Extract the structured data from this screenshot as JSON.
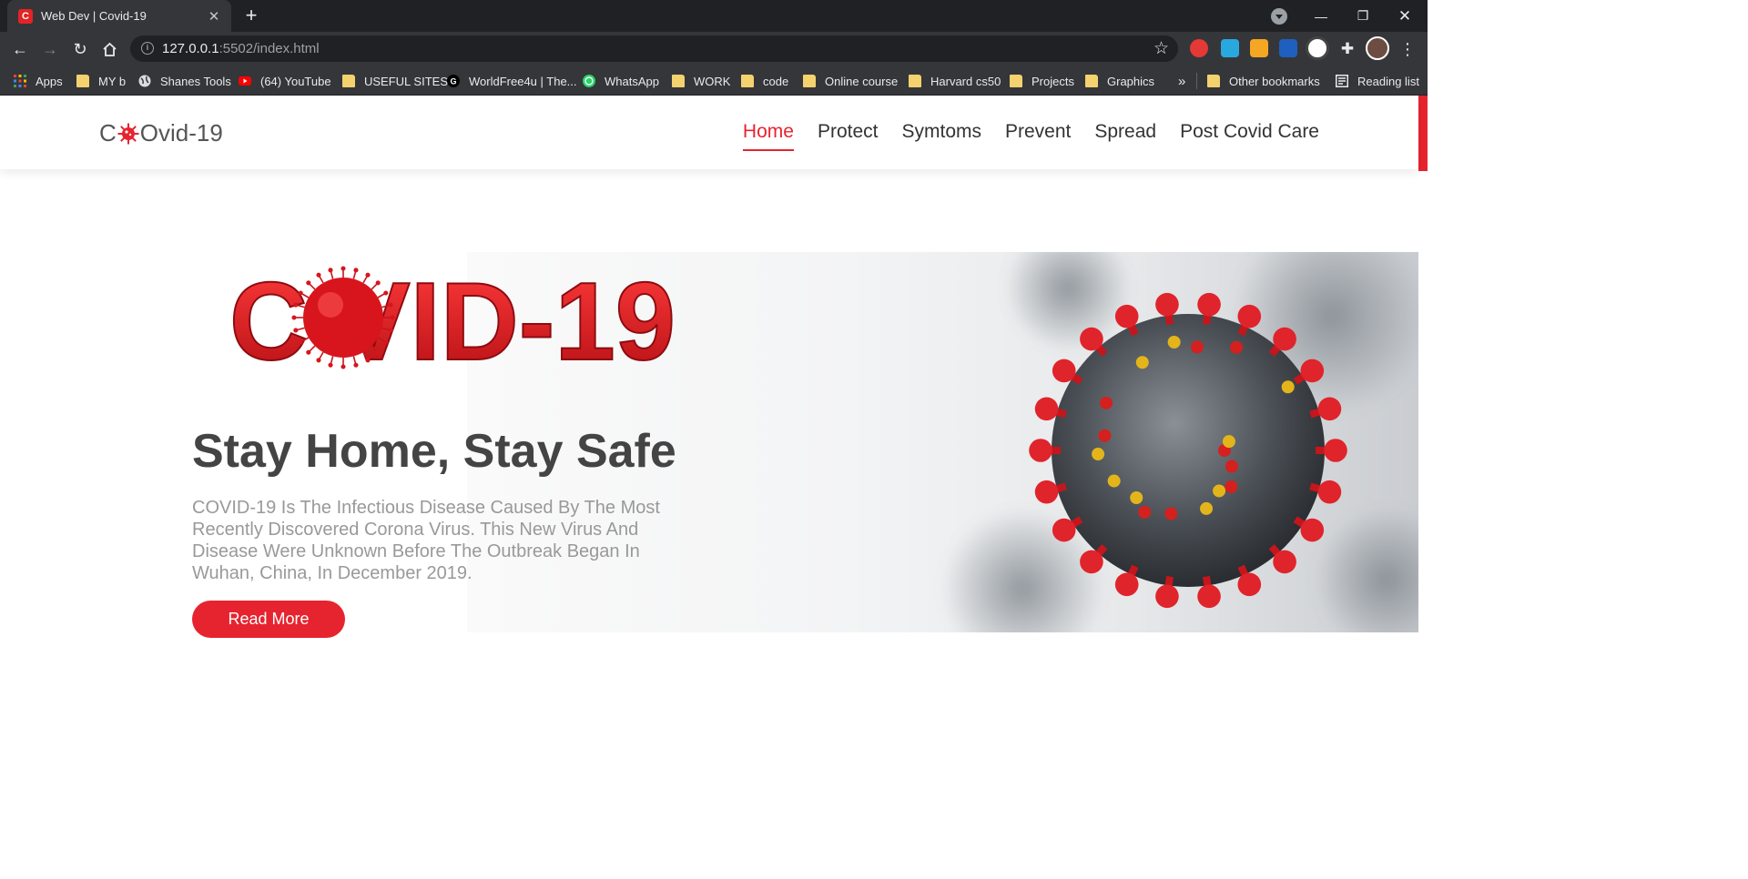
{
  "browser": {
    "tab_title": "Web Dev | Covid-19",
    "tab_favicon_letter": "C",
    "url_host": "127.0.0.1",
    "url_rest": ":5502/index.html",
    "bookmarks": [
      {
        "label": "Apps",
        "icon": "apps-grid-icon"
      },
      {
        "label": "MY b",
        "icon": "folder-icon"
      },
      {
        "label": "Shanes Tools",
        "icon": "globe-icon"
      },
      {
        "label": "(64) YouTube",
        "icon": "youtube-icon"
      },
      {
        "label": "USEFUL SITES",
        "icon": "folder-icon"
      },
      {
        "label": "WorldFree4u | The...",
        "icon": "g-site-icon"
      },
      {
        "label": "WhatsApp",
        "icon": "whatsapp-icon"
      },
      {
        "label": "WORK",
        "icon": "folder-icon"
      },
      {
        "label": "code",
        "icon": "folder-icon"
      },
      {
        "label": "Online course",
        "icon": "folder-icon"
      },
      {
        "label": "Harvard cs50",
        "icon": "folder-icon"
      },
      {
        "label": "Projects",
        "icon": "folder-icon"
      },
      {
        "label": "Graphics",
        "icon": "folder-icon"
      }
    ],
    "overflow_label": "»",
    "other_bookmarks": "Other bookmarks",
    "reading_list": "Reading list"
  },
  "site": {
    "logo_prefix": "C",
    "logo_suffix": "Ovid-19",
    "nav": [
      "Home",
      "Protect",
      "Symtoms",
      "Prevent",
      "Spread",
      "Post Covid Care"
    ],
    "active_nav": "Home",
    "hero_logo_text": "C VID-19",
    "hero_title": "Stay Home, Stay Safe",
    "hero_text": "COVID-19 Is The Infectious Disease Caused By The Most Recently Discovered Corona Virus. This New Virus And Disease Were Unknown Before The Outbreak Began In Wuhan, China, In December 2019.",
    "read_more": "Read More"
  },
  "colors": {
    "accent": "#e6242f",
    "heading": "#444444",
    "body_text": "#999999"
  }
}
